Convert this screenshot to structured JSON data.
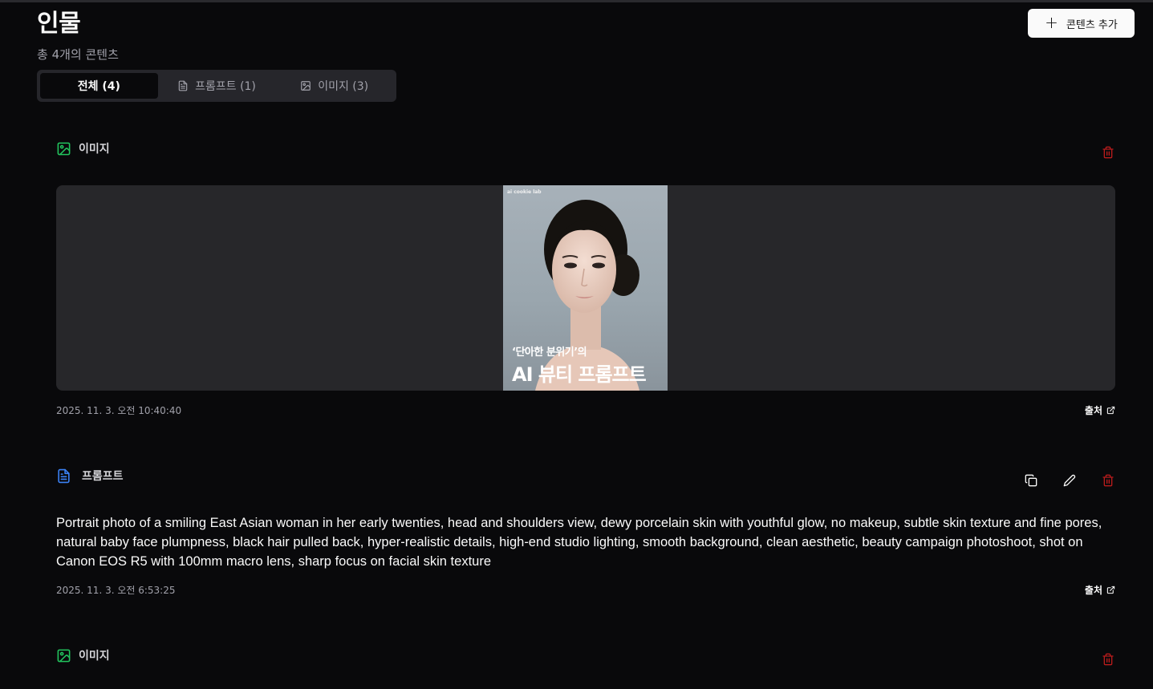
{
  "page": {
    "title": "인물",
    "subtitle": "총 4개의 콘텐츠",
    "add_button_label": "콘텐츠 추가"
  },
  "tabs": [
    {
      "label": "전체 (4)",
      "active": true
    },
    {
      "label": "프롬프트 (1)",
      "icon": "document-icon"
    },
    {
      "label": "이미지 (3)",
      "icon": "image-icon"
    }
  ],
  "items": [
    {
      "type_label": "이미지",
      "thumbnail": {
        "brand": "ai cookie lab",
        "small_text": "‘단아한 분위기’의",
        "big_text": "AI 뷰티 프롬프트"
      },
      "date": "2025. 11. 3. 오전 10:40:40",
      "source_label": "출처"
    },
    {
      "type_label": "프롬프트",
      "text": "Portrait photo of a smiling East Asian woman in her early twenties, head and shoulders view, dewy porcelain skin with youthful glow, no makeup, subtle skin texture and fine pores, natural baby face plumpness, black hair pulled back, hyper-realistic details, high-end studio lighting, smooth background, clean aesthetic, beauty campaign photoshoot, shot on Canon EOS R5 with 100mm macro lens, sharp focus on facial skin texture",
      "date": "2025. 11. 3. 오전 6:53:25",
      "source_label": "출처"
    },
    {
      "type_label": "이미지"
    }
  ],
  "colors": {
    "background": "#09090b",
    "image_icon": "#22c55e",
    "document_icon": "#3b82f6",
    "delete_icon": "#b91c1c"
  }
}
